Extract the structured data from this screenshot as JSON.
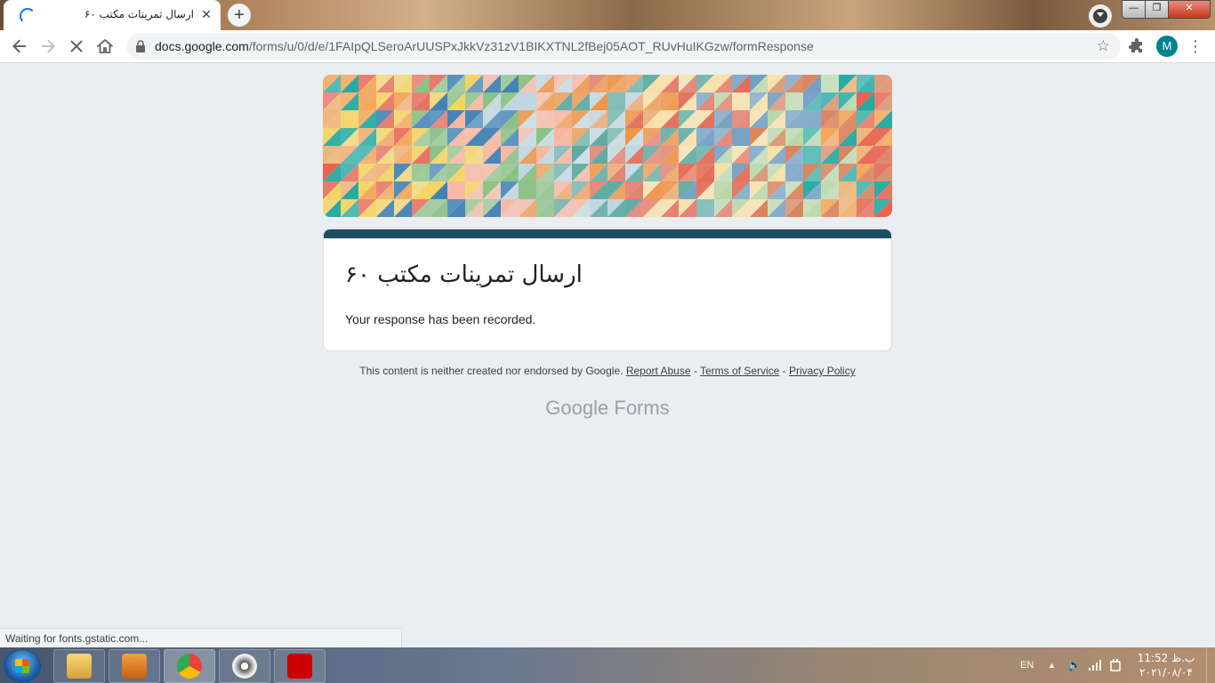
{
  "browser": {
    "tab": {
      "title": "ارسال تمرینات مکتب ۶۰",
      "close": "✕"
    },
    "new_tab": "+",
    "window_controls": {
      "minimize": "—",
      "maximize": "❐",
      "close": "✕"
    },
    "url": {
      "host": "docs.google.com",
      "path": "/forms/u/0/d/e/1FAIpQLSeroArUUSPxJkkVz31zV1BIKXTNL2fBej05AOT_RUvHuIKGzw/formResponse"
    },
    "profile_initial": "M",
    "status": "Waiting for fonts.gstatic.com..."
  },
  "form": {
    "title": "ارسال تمرینات مکتب ۶۰",
    "confirmation": "Your response has been recorded.",
    "accent": "#1d4e63"
  },
  "footer": {
    "disclaimer": "This content is neither created nor endorsed by Google.",
    "report_abuse": "Report Abuse",
    "sep1": " - ",
    "terms": "Terms of Service",
    "sep2": " - ",
    "privacy": "Privacy Policy",
    "brand_google": "Google",
    "brand_forms": "Forms"
  },
  "taskbar": {
    "language": "EN",
    "time": "11:52 ب.ظ",
    "date": "۲۰۲۱/۰۸/۰۴"
  }
}
